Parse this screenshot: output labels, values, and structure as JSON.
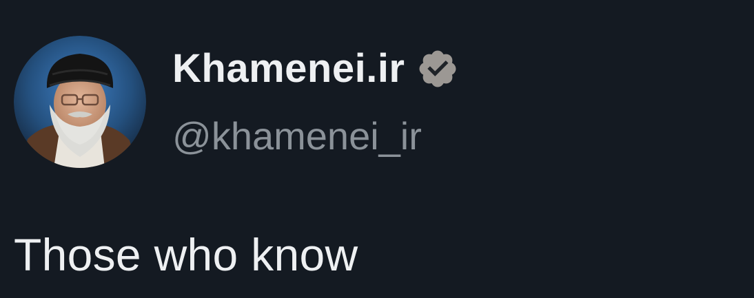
{
  "author": {
    "display_name": "Khamenei.ir",
    "handle": "@khamenei_ir",
    "verified": true,
    "verified_badge_icon": "verified-badge-icon",
    "verified_badge_color": "#9c9894",
    "avatar_icon": "profile-avatar"
  },
  "tweet": {
    "text": "Those who know"
  },
  "colors": {
    "background": "#141a22",
    "primary_text": "#eef0f2",
    "secondary_text": "#8b9299"
  }
}
